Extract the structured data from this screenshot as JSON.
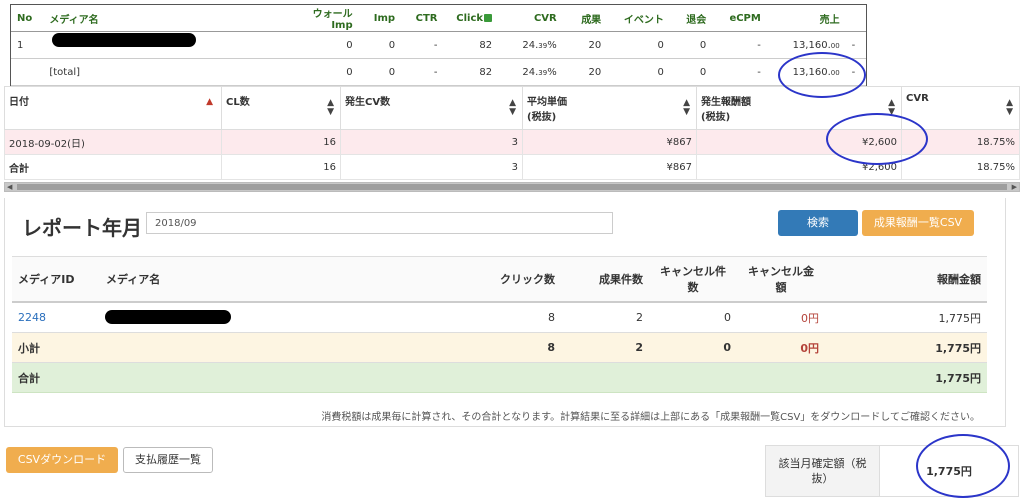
{
  "top_report": {
    "columns": [
      "No",
      "メディア名",
      "ウォールImp",
      "Imp",
      "CTR",
      "Click",
      "CVR",
      "成果",
      "イベント",
      "退会",
      "eCPM",
      "売上"
    ],
    "row": {
      "no": "1",
      "wall_imp": "0",
      "imp": "0",
      "ctr": "-",
      "click": "82",
      "cvr_main": "24.",
      "cvr_dec": "39",
      "cvr_pct": "%",
      "results": "20",
      "events": "0",
      "withdrawals": "0",
      "ecpm": "-",
      "sales_main": "13,160.",
      "sales_dec": "00",
      "trail": "-"
    },
    "total": {
      "label": "[total]",
      "wall_imp": "0",
      "imp": "0",
      "ctr": "-",
      "click": "82",
      "cvr_main": "24.",
      "cvr_dec": "39",
      "cvr_pct": "%",
      "results": "20",
      "events": "0",
      "withdrawals": "0",
      "ecpm": "-",
      "sales_main": "13,160.",
      "sales_dec": "00",
      "trail": "-"
    }
  },
  "daily_report": {
    "columns": {
      "date": "日付",
      "cl": "CL数",
      "cv": "発生CV数",
      "avg1": "平均単価",
      "avg2": "(税抜)",
      "reward1": "発生報酬額",
      "reward2": "(税抜)",
      "cvr": "CVR"
    },
    "row": {
      "date": "2018-09-02(日)",
      "cl": "16",
      "cv": "3",
      "avg": "¥867",
      "reward": "¥2,600",
      "cvr": "18.75%"
    },
    "total": {
      "label": "合計",
      "cl": "16",
      "cv": "3",
      "avg": "¥867",
      "reward": "¥2,600",
      "cvr": "18.75%"
    }
  },
  "monthly": {
    "title": "レポート年月",
    "month_value": "2018/09",
    "search_label": "検索",
    "csv_list_label": "成果報酬一覧CSV",
    "columns": {
      "media_id": "メディアID",
      "media_name": "メディア名",
      "clicks": "クリック数",
      "results": "成果件数",
      "cancel_count1": "キャンセル件",
      "cancel_count2": "数",
      "cancel_amount1": "キャンセル金",
      "cancel_amount2": "額",
      "reward": "報酬金額"
    },
    "row": {
      "media_id": "2248",
      "clicks": "8",
      "results": "2",
      "cancel_count": "0",
      "cancel_amount": "0円",
      "reward": "1,775円"
    },
    "subtotal": {
      "label": "小計",
      "clicks": "8",
      "results": "2",
      "cancel_count": "0",
      "cancel_amount": "0円",
      "reward": "1,775円"
    },
    "total": {
      "label": "合計",
      "reward": "1,775円"
    },
    "note": "消費税額は成果毎に計算され、その合計となります。計算結果に至る詳細は上部にある「成果報酬一覧CSV」をダウンロードしてご確認ください。",
    "csv_download_label": "CSVダウンロード",
    "payment_history_label": "支払履歴一覧",
    "confirmed_label1": "該当月確定額（税",
    "confirmed_label2": "抜）",
    "confirmed_value": "1,775円"
  },
  "colors": {
    "annotation": "#2b35c9",
    "primary": "#337ab7",
    "warning": "#f0ad4e",
    "subtotal_bg": "#fdf5e2",
    "total_bg": "#e0f0d9"
  }
}
